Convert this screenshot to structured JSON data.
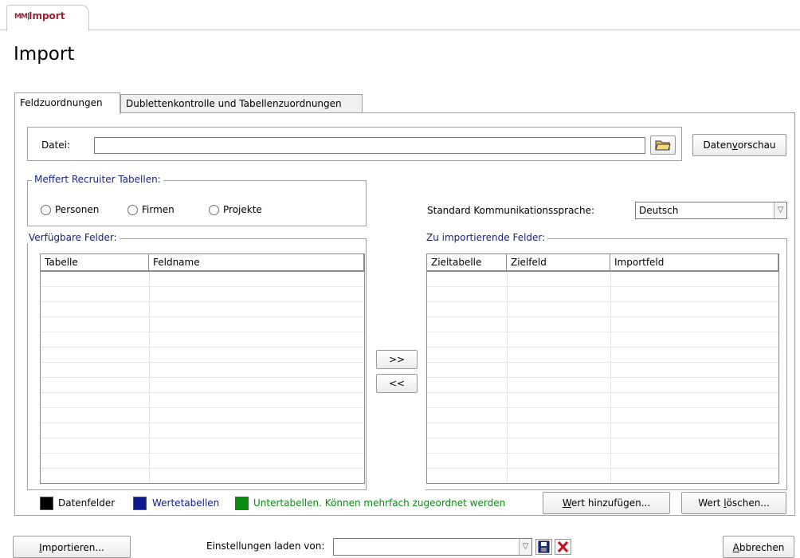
{
  "window": {
    "tab_label": "Import",
    "tab_icon": "MM|",
    "form_title": "Import"
  },
  "tabs": [
    {
      "label": "Feldzuordnungen",
      "active": true
    },
    {
      "label": "Dublettenkontrolle und Tabellenzuordnungen",
      "active": false
    }
  ],
  "file": {
    "label": "Datei:",
    "value": "",
    "browse_icon": "folder-open-icon",
    "preview_button_pre": "Daten",
    "preview_button_hotkey": "v",
    "preview_button_post": "orschau"
  },
  "tables_group": {
    "title": "Meffert Recruiter Tabellen:",
    "options": [
      "Personen",
      "Firmen",
      "Projekte"
    ],
    "selected": null
  },
  "language": {
    "label": "Standard Kommunikationssprache:",
    "value": "Deutsch"
  },
  "available_fields": {
    "title": "Verfügbare Felder:",
    "columns": [
      "Tabelle",
      "Feldname"
    ],
    "rows": []
  },
  "import_fields": {
    "title": "Zu importierende Felder:",
    "columns": [
      "Zieltabelle",
      "Zielfeld",
      "Importfeld"
    ],
    "rows": []
  },
  "transfer": {
    "add_label": ">>",
    "remove_label": "<<"
  },
  "legend": [
    {
      "label": "Datenfelder",
      "color": "#000000",
      "text_color": "#000000"
    },
    {
      "label": "Wertetabellen",
      "color": "#0d1a8c",
      "text_color": "#0d1a8c"
    },
    {
      "label": "Untertabellen. Können mehrfach zugeordnet werden",
      "color": "#0b8a12",
      "text_color": "#0b8a12"
    }
  ],
  "value_buttons": {
    "add_hotkey": "W",
    "add_rest": "ert hinzufügen...",
    "delete_pre": "Wert ",
    "delete_hotkey": "l",
    "delete_rest": "öschen..."
  },
  "bottom": {
    "import_hotkey": "I",
    "import_rest": "mportieren...",
    "settings_label": "Einstellungen laden von:",
    "settings_value": "",
    "save_icon": "save-icon",
    "delete_icon": "delete-x-icon",
    "cancel_hotkey": "A",
    "cancel_rest": "bbrechen"
  }
}
